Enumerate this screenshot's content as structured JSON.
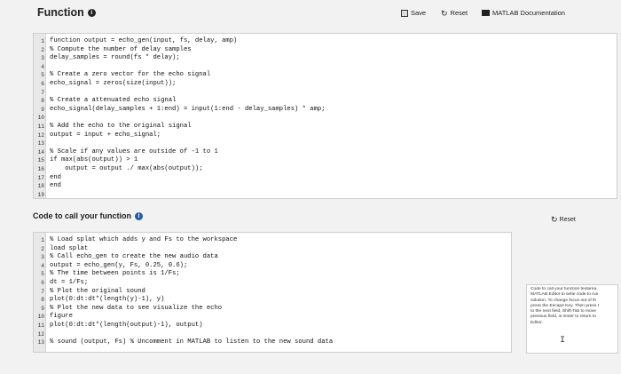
{
  "header": {
    "title": "Function",
    "save_label": "Save",
    "reset_label": "Reset",
    "docs_label": "MATLAB Documentation"
  },
  "function_code": [
    "function output = echo_gen(input, fs, delay, amp)",
    "% Compute the number of delay samples",
    "delay_samples = round(fs * delay);",
    "",
    "% Create a zero vector for the echo signal",
    "echo_signal = zeros(size(input));",
    "",
    "% Create a attenuated echo signal",
    "echo_signal(delay_samples + 1:end) = input(1:end - delay_samples) * amp;",
    "",
    "% Add the echo to the original signal",
    "output = input + echo_signal;",
    "",
    "% Scale if any values are outside of -1 to 1",
    "if max(abs(output)) > 1",
    "    output = output ./ max(abs(output));",
    "end",
    "end",
    ""
  ],
  "call_section": {
    "title": "Code to call your function",
    "reset_label": "Reset",
    "code": [
      "% Load splat which adds y and Fs to the workspace",
      "load splat",
      "% Call echo_gen to create the new audio data",
      "output = echo_gen(y, Fs, 0.25, 0.6);",
      "% The time between points is 1/Fs;",
      "dt = 1/Fs;",
      "% Plot the original sound",
      "plot(0:dt:dt*(length(y)-1), y)",
      "% Plot the new data to see visualize the echo",
      "figure",
      "plot(0:dt:dt*(length(output)-1), output)",
      "",
      "% sound (output, Fs) % Uncomment in MATLAB to listen to the new sound data"
    ]
  },
  "side_panel": {
    "text": "Code to call your function textarea.\nMATLAB Editor to write code to run\nsolution. To change focus out of th\npress the Escape Key. Then press t\nto the next field, Shift-Tab to move\nprevious field, or Enter to return to\nEditor."
  }
}
